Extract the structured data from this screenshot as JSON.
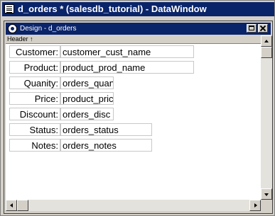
{
  "app": {
    "window_title": "d_orders * (salesdb_tutorial) - DataWindow",
    "icon": "datawindow-icon"
  },
  "child": {
    "title": "Design - d_orders",
    "icon": "design-view-icon",
    "buttons": [
      "restore",
      "close"
    ]
  },
  "band": {
    "header_label": "Header ↑"
  },
  "fields": [
    {
      "label": "Customer:",
      "column": "customer_cust_name"
    },
    {
      "label": "Product:",
      "column": "product_prod_name"
    },
    {
      "label": "Quanity:",
      "column": "orders_quan"
    },
    {
      "label": "Price:",
      "column": "product_pric"
    },
    {
      "label": "Discount:",
      "column": "orders_disc"
    },
    {
      "label": "Status:",
      "column": "orders_status"
    },
    {
      "label": "Notes:",
      "column": "orders_notes"
    }
  ],
  "colors": {
    "title_bar": "#0a246a",
    "face": "#d4d0c8",
    "canvas": "#ffffff"
  }
}
